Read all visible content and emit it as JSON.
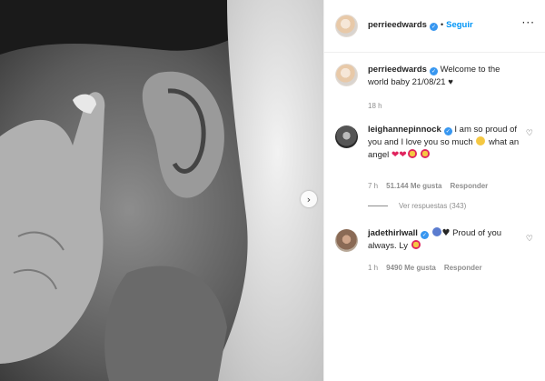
{
  "post": {
    "username": "perrieedwards",
    "follow_label": "Seguir",
    "separator": "•",
    "more_icon": "more-horizontal-icon"
  },
  "caption": {
    "username": "perrieedwards",
    "text": "Welcome to the world baby 21/08/21 ♥",
    "age": "18 h"
  },
  "comments": [
    {
      "username": "leighannepinnock",
      "text_a": "I am so proud of you and I love you so much",
      "text_b": "what an angel",
      "age": "7 h",
      "likes": "51.144 Me gusta",
      "reply_label": "Responder",
      "view_replies": "Ver respuestas (343)"
    },
    {
      "username": "jadethirlwall",
      "text": "Proud of you always. Ly",
      "age": "1 h",
      "likes": "9490 Me gusta",
      "reply_label": "Responder"
    }
  ],
  "colors": {
    "accent": "#0095f6",
    "verified": "#3897f0",
    "muted": "#8e8e8e"
  }
}
